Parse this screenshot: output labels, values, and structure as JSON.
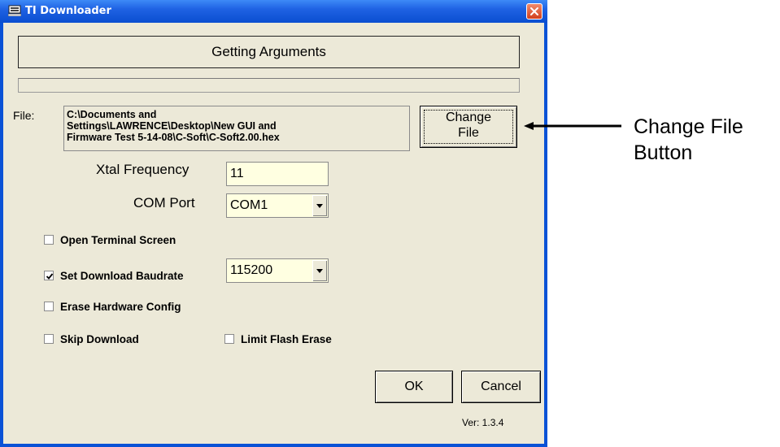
{
  "window": {
    "title": "TI Downloader",
    "status_text": "Getting Arguments",
    "progress": 0
  },
  "file": {
    "label": "File:",
    "path_lines": [
      "C:\\Documents and",
      "Settings\\LAWRENCE\\Desktop\\New GUI and",
      "Firmware Test 5-14-08\\C-Soft\\C-Soft2.00.hex"
    ],
    "change_button_lines": [
      "Change",
      "File"
    ]
  },
  "xtal": {
    "label": "Xtal Frequency",
    "value": "11"
  },
  "com": {
    "label": "COM Port",
    "selected": "COM1"
  },
  "options": {
    "open_terminal": {
      "label": "Open Terminal Screen",
      "checked": false
    },
    "set_baud": {
      "label": "Set Download Baudrate",
      "checked": true,
      "selected": "115200"
    },
    "erase_config": {
      "label": "Erase Hardware Config",
      "checked": false
    },
    "skip_download": {
      "label": "Skip Download",
      "checked": false
    },
    "limit_flash": {
      "label": "Limit Flash Erase",
      "checked": false
    }
  },
  "buttons": {
    "ok": "OK",
    "cancel": "Cancel"
  },
  "version": "Ver: 1.3.4",
  "annotation": {
    "lines": [
      "Change File",
      "Button"
    ]
  },
  "icons": {
    "app": "app-icon",
    "close": "close-icon",
    "dropdown": "chevron-down-icon",
    "check": "check-icon",
    "arrow": "arrow-left-icon"
  },
  "colors": {
    "titlebar": "#0a52d6",
    "client_bg": "#ece9d8",
    "input_bg": "#ffffe1",
    "close_red": "#d2401d"
  }
}
